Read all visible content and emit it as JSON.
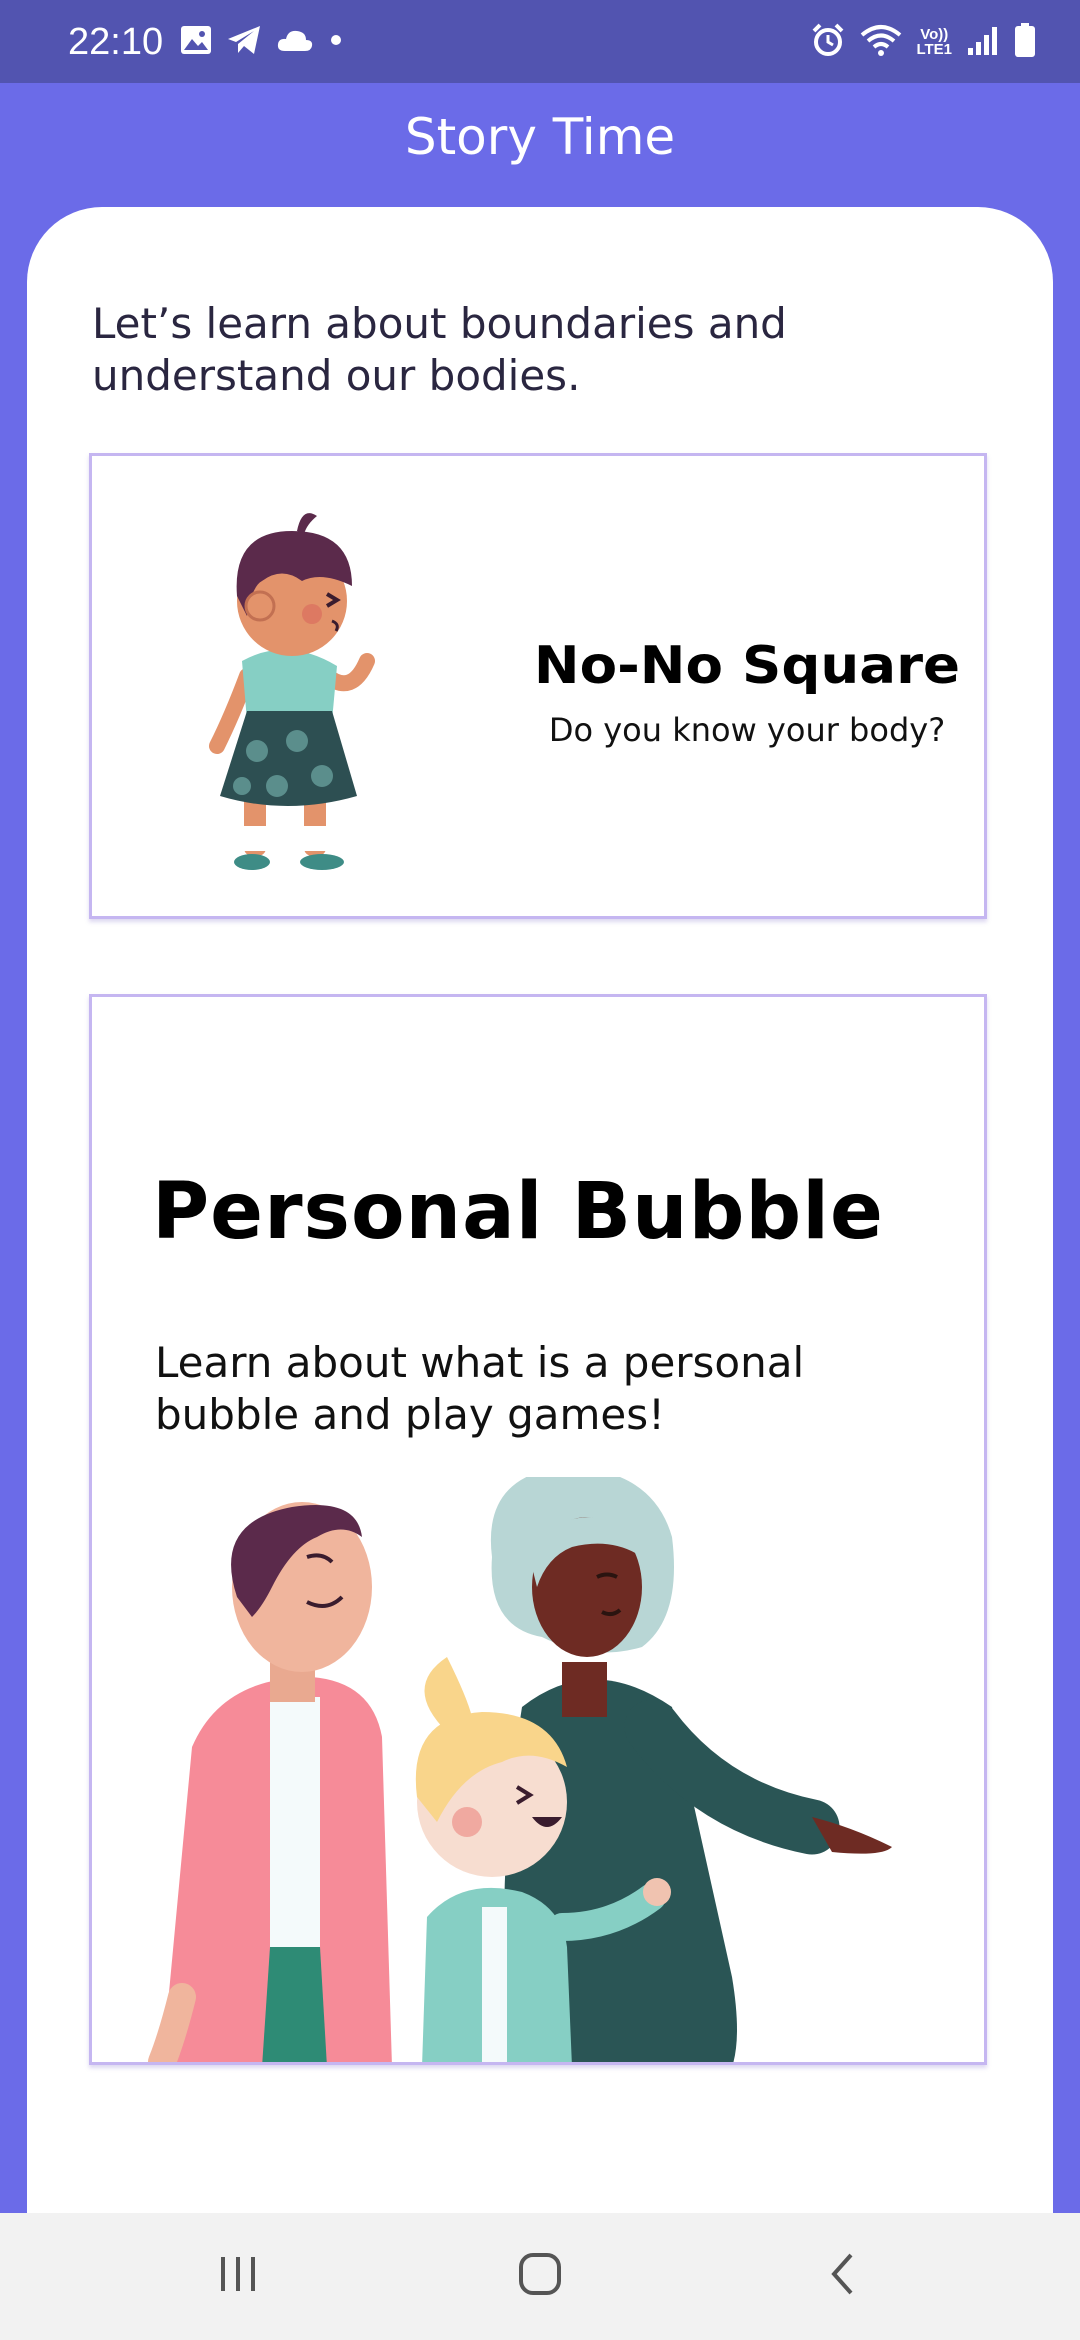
{
  "status_bar": {
    "time": "22:10",
    "network_label_top": "Vo))",
    "network_label_bottom": "LTE1"
  },
  "header": {
    "title": "Story Time"
  },
  "intro": {
    "text": "Let’s learn about boundaries and understand our bodies."
  },
  "cards": [
    {
      "title": "No-No Square",
      "subtitle": "Do you know your body?"
    },
    {
      "title": "Personal Bubble",
      "subtitle": "Learn about what is a personal bubble and play games!"
    }
  ],
  "colors": {
    "status_bar": "#5254b0",
    "header": "#6b6be8",
    "card_border": "#c5b6f1",
    "nav_bar": "#f2f2f2"
  },
  "icons": {
    "status_left": [
      "image-icon",
      "telegram-icon",
      "cloud-icon",
      "dot-icon"
    ],
    "status_right": [
      "alarm-icon",
      "wifi-icon",
      "signal-icon",
      "battery-icon"
    ],
    "navigation": [
      "recents-icon",
      "home-icon",
      "back-icon"
    ]
  }
}
